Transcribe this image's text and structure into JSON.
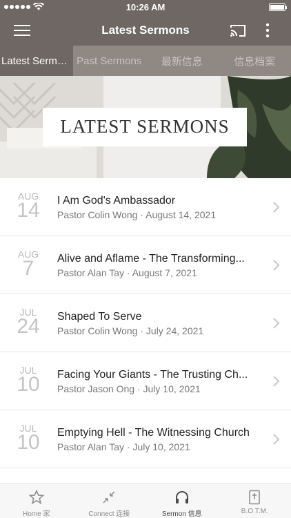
{
  "status": {
    "time": "10:26 AM"
  },
  "nav": {
    "title": "Latest Sermons"
  },
  "tabs": [
    {
      "label": "Latest Sermo...",
      "active": true
    },
    {
      "label": "Past Sermons",
      "active": false
    },
    {
      "label": "最新信息",
      "active": false
    },
    {
      "label": "信息档案",
      "active": false
    }
  ],
  "banner": {
    "title": "LATEST SERMONS"
  },
  "sermons": [
    {
      "month": "AUG",
      "day": "14",
      "title": "I Am God's Ambassador",
      "subtitle": "Pastor Colin Wong · August 14, 2021"
    },
    {
      "month": "AUG",
      "day": "7",
      "title": "Alive and Aflame - The Transforming...",
      "subtitle": "Pastor Alan Tay · August 7, 2021"
    },
    {
      "month": "JUL",
      "day": "24",
      "title": "Shaped To Serve",
      "subtitle": "Pastor Colin Wong · July 24, 2021"
    },
    {
      "month": "JUL",
      "day": "10",
      "title": "Facing Your Giants - The Trusting Ch...",
      "subtitle": "Pastor Jason Ong · July 10, 2021"
    },
    {
      "month": "JUL",
      "day": "10",
      "title": "Emptying Hell - The Witnessing Church",
      "subtitle": "Pastor Alan Tay · July 10, 2021"
    }
  ],
  "bottom_tabs": [
    {
      "label": "Home 家",
      "icon": "star-icon",
      "active": false
    },
    {
      "label": "Connect 连接",
      "icon": "connect-arrows-icon",
      "active": false
    },
    {
      "label": "Sermon 信息",
      "icon": "headphones-icon",
      "active": true
    },
    {
      "label": "B.O.T.M.",
      "icon": "bible-icon",
      "active": false
    }
  ],
  "colors": {
    "header": "#6e6763",
    "tab_bar": "#8f8883",
    "active_tab": "#6e6763"
  }
}
